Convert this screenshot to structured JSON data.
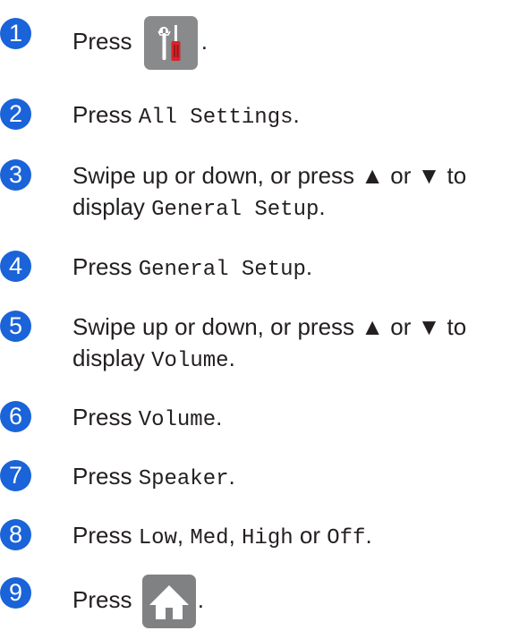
{
  "steps": [
    {
      "num": "1",
      "pre": "Press ",
      "post": "."
    },
    {
      "num": "2",
      "pre": "Press ",
      "code": "All Settings",
      "post": "."
    },
    {
      "num": "3",
      "pre": "Swipe up or down, or press ▲ or ▼ to",
      "line2_pre": "display ",
      "code": "General Setup",
      "post": "."
    },
    {
      "num": "4",
      "pre": "Press ",
      "code": "General Setup",
      "post": "."
    },
    {
      "num": "5",
      "pre": "Swipe up or down, or press ▲ or ▼ to",
      "line2_pre": "display ",
      "code": "Volume",
      "post": "."
    },
    {
      "num": "6",
      "pre": "Press ",
      "code": "Volume",
      "post": "."
    },
    {
      "num": "7",
      "pre": "Press ",
      "code": "Speaker",
      "post": "."
    },
    {
      "num": "8",
      "pre": "Press ",
      "code1": "Low",
      "sep1": ", ",
      "code2": "Med",
      "sep2": ", ",
      "code3": "High",
      "sep3": " or ",
      "code4": "Off",
      "post": "."
    },
    {
      "num": "9",
      "pre": "Press ",
      "post": "."
    }
  ],
  "icons": {
    "step1": "settings-tools-icon",
    "step9": "home-icon"
  }
}
